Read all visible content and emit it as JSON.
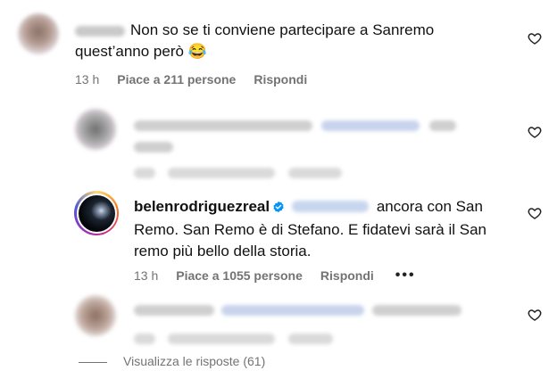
{
  "comments": [
    {
      "text": "Non so se ti conviene partecipare a Sanremo quest’anno però 😂",
      "time": "13 h",
      "likes": "Piace a 211 persone",
      "reply": "Rispondi"
    },
    {
      "username": "belenrodriguezreal",
      "text": "ancora con San Remo. San Remo è di Stefano. E fidatevi sarà il San remo più bello della storia.",
      "time": "13 h",
      "likes": "Piace a 1055 persone",
      "reply": "Rispondi",
      "more": "•••"
    }
  ],
  "view_replies": "Visualizza le risposte (61)",
  "colors": {
    "meta": "#737373",
    "verified": "#0095f6",
    "story_ring": "#d62976"
  },
  "icons": [
    "heart-icon",
    "verified-badge-icon",
    "more-options-icon"
  ]
}
